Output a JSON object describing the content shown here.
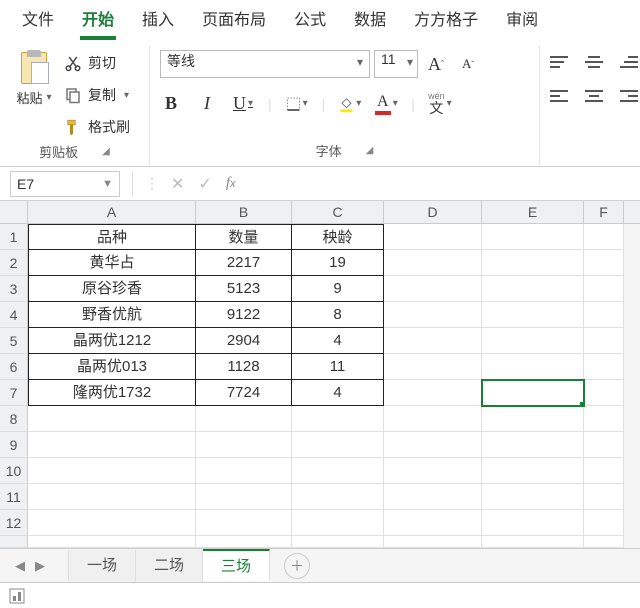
{
  "tabs": [
    "文件",
    "开始",
    "插入",
    "页面布局",
    "公式",
    "数据",
    "方方格子",
    "审阅"
  ],
  "active_tab": 1,
  "clipboard": {
    "paste": "粘贴",
    "cut": "剪切",
    "copy": "复制",
    "format_painter": "格式刷",
    "group_title": "剪贴板"
  },
  "font": {
    "name": "等线",
    "size": "11",
    "group_title": "字体",
    "wen_top": "wén",
    "wen_bottom": "文"
  },
  "name_box": "E7",
  "columns": [
    "A",
    "B",
    "C",
    "D",
    "E",
    "F"
  ],
  "data_headers": {
    "c0": "品种",
    "c1": "数量",
    "c2": "秧龄"
  },
  "chart_data": {
    "type": "table",
    "columns": [
      "品种",
      "数量",
      "秧龄"
    ],
    "rows": [
      {
        "c0": "黄华占",
        "c1": "2217",
        "c2": "19"
      },
      {
        "c0": "原谷珍香",
        "c1": "5123",
        "c2": "9"
      },
      {
        "c0": "野香优航",
        "c1": "9122",
        "c2": "8"
      },
      {
        "c0": "晶两优1212",
        "c1": "2904",
        "c2": "4"
      },
      {
        "c0": "晶两优013",
        "c1": "1128",
        "c2": "11"
      },
      {
        "c0": "隆两优1732",
        "c1": "7724",
        "c2": "4"
      }
    ]
  },
  "row_numbers": [
    "1",
    "2",
    "3",
    "4",
    "5",
    "6",
    "7",
    "8",
    "9",
    "10",
    "11",
    "12"
  ],
  "sheets": [
    "一场",
    "二场",
    "三场"
  ],
  "active_sheet": 2
}
